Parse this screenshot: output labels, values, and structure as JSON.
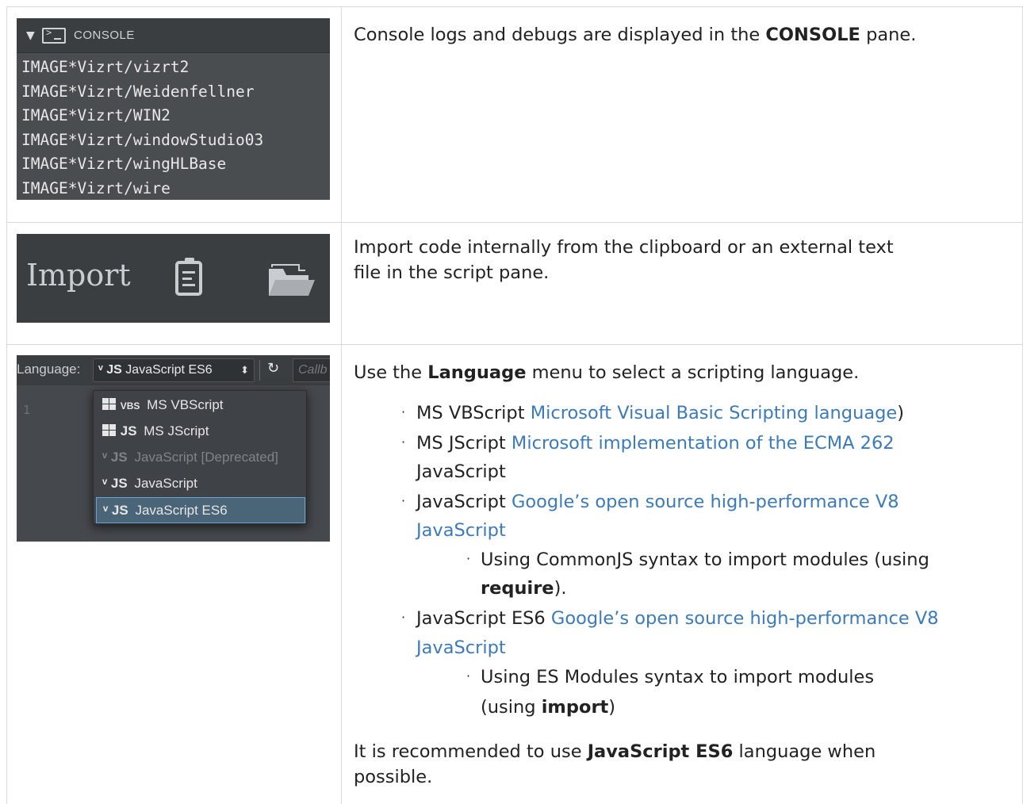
{
  "console_panel": {
    "header_title": "CONSOLE",
    "lines": [
      "IMAGE*Vizrt/vizrt2",
      "IMAGE*Vizrt/Weidenfellner",
      "IMAGE*Vizrt/WIN2",
      "IMAGE*Vizrt/windowStudio03",
      "IMAGE*Vizrt/wingHLBase",
      "IMAGE*Vizrt/wire"
    ],
    "icons": [
      "collapse-triangle-icon",
      "terminal-icon"
    ]
  },
  "console_description": {
    "pre": "Console logs and debugs are displayed in the ",
    "bold": "CONSOLE",
    "post": " pane."
  },
  "import_panel": {
    "label": "Import",
    "icons": [
      "clipboard-icon",
      "folder-open-icon"
    ]
  },
  "import_description": {
    "line1": "Import code internally from the clipboard or an external text",
    "line2": "file in the script pane."
  },
  "language_panel": {
    "caption": "Language:",
    "selected": "JavaScript ES6",
    "selected_icon": "JS",
    "callback_placeholder": "Callb",
    "gutter_line": "1",
    "options": [
      {
        "icon": "VBS",
        "label": "MS VBScript",
        "disabled": false,
        "selected": false
      },
      {
        "icon": "JS",
        "label": "MS JScript",
        "disabled": false,
        "selected": false
      },
      {
        "icon": "JS",
        "label": "JavaScript [Deprecated]",
        "disabled": true,
        "selected": false
      },
      {
        "icon": "JS",
        "label": "JavaScript",
        "disabled": false,
        "selected": false
      },
      {
        "icon": "JS",
        "label": "JavaScript ES6",
        "disabled": false,
        "selected": true
      }
    ]
  },
  "language_description": {
    "intro_pre": "Use the ",
    "intro_bold": "Language",
    "intro_post": " menu to select a scripting language.",
    "b1_text": "MS VBScript ",
    "b1_link": "Microsoft Visual Basic Scripting language",
    "b1_post": ")",
    "b2_text": "MS JScript ",
    "b2_link": "Microsoft implementation of the ECMA 262",
    "b2_cont": "JavaScript",
    "b3_text": "JavaScript ",
    "b3_link1": "Google’s open source high-performance V8",
    "b3_link2": "JavaScript",
    "b3_sub_pre": "Using CommonJS syntax to import modules (using",
    "b3_sub_bold": "require",
    "b3_sub_post": ").",
    "b4_text": "JavaScript ES6 ",
    "b4_link1": "Google’s open source high-performance V8",
    "b4_link2": "JavaScript",
    "b4_sub_line1": "Using ES Modules syntax to import modules",
    "b4_sub_pre": "(using ",
    "b4_sub_bold": "import",
    "b4_sub_post": ")",
    "rec_pre": "It is recommended to use ",
    "rec_bold": "JavaScript ES6",
    "rec_post": " language when",
    "rec_line2": "possible."
  },
  "colors": {
    "link": "#3d7ab8",
    "panel_dark": "#3b3e41",
    "panel_mid": "#4a4d50",
    "selection": "#4a6478"
  }
}
